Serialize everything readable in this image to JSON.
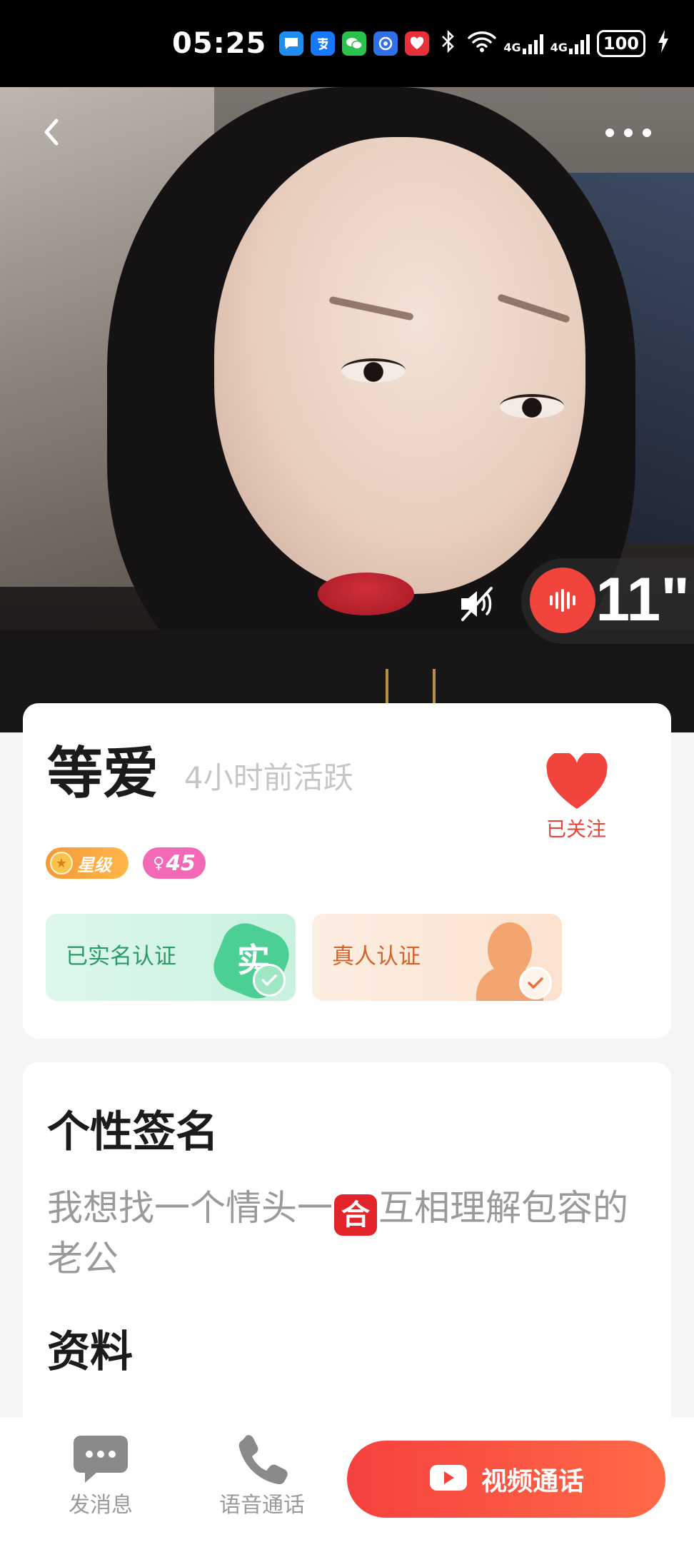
{
  "status_bar": {
    "time": "05:25",
    "network_type_1": "4G",
    "network_type_2": "4G",
    "battery": "100",
    "notification_icons": [
      "message-icon",
      "alipay-icon",
      "wechat-icon",
      "app-icon",
      "app-icon-red"
    ],
    "system_icons": [
      "bluetooth-icon",
      "wifi-icon",
      "signal-icon",
      "signal-icon",
      "battery-icon",
      "charging-icon"
    ]
  },
  "header": {
    "back_icon": "chevron-left-icon",
    "more_icon": "more-dots-icon"
  },
  "media": {
    "mute_icon": "speaker-muted-icon",
    "voice_duration": "11\""
  },
  "profile": {
    "name": "等爱",
    "active_status": "4小时前活跃",
    "follow_label": "已关注",
    "badges": {
      "level_label": "星级",
      "age": "45"
    },
    "verifications": {
      "real_name_label": "已实名认证",
      "real_name_seal": "实",
      "real_person_label": "真人认证"
    }
  },
  "bio": {
    "title": "个性签名",
    "text_before": "我想找一个情头一",
    "emoji": "合",
    "text_after": "互相理解包容的老公"
  },
  "details": {
    "title": "资料"
  },
  "bottom_bar": {
    "message_label": "发消息",
    "voice_call_label": "语音通话",
    "video_call_label": "视频通话"
  },
  "colors": {
    "accent": "#f6413f",
    "follow_heart": "#f0443c",
    "verified_green": "#2b9a66",
    "real_person_orange": "#d4622a",
    "level_badge": "#f29a3a",
    "age_badge": "#f26ab5"
  }
}
